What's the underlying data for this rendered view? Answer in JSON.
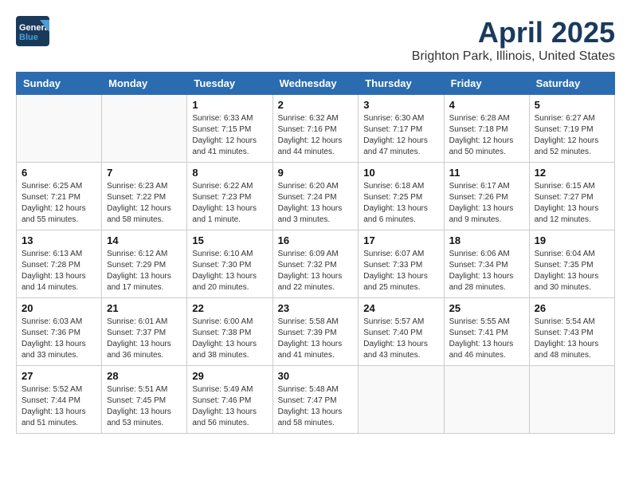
{
  "header": {
    "logo_line1": "General",
    "logo_line2": "Blue",
    "title": "April 2025",
    "subtitle": "Brighton Park, Illinois, United States"
  },
  "days_of_week": [
    "Sunday",
    "Monday",
    "Tuesday",
    "Wednesday",
    "Thursday",
    "Friday",
    "Saturday"
  ],
  "weeks": [
    [
      {
        "day": "",
        "info": ""
      },
      {
        "day": "",
        "info": ""
      },
      {
        "day": "1",
        "info": "Sunrise: 6:33 AM\nSunset: 7:15 PM\nDaylight: 12 hours and 41 minutes."
      },
      {
        "day": "2",
        "info": "Sunrise: 6:32 AM\nSunset: 7:16 PM\nDaylight: 12 hours and 44 minutes."
      },
      {
        "day": "3",
        "info": "Sunrise: 6:30 AM\nSunset: 7:17 PM\nDaylight: 12 hours and 47 minutes."
      },
      {
        "day": "4",
        "info": "Sunrise: 6:28 AM\nSunset: 7:18 PM\nDaylight: 12 hours and 50 minutes."
      },
      {
        "day": "5",
        "info": "Sunrise: 6:27 AM\nSunset: 7:19 PM\nDaylight: 12 hours and 52 minutes."
      }
    ],
    [
      {
        "day": "6",
        "info": "Sunrise: 6:25 AM\nSunset: 7:21 PM\nDaylight: 12 hours and 55 minutes."
      },
      {
        "day": "7",
        "info": "Sunrise: 6:23 AM\nSunset: 7:22 PM\nDaylight: 12 hours and 58 minutes."
      },
      {
        "day": "8",
        "info": "Sunrise: 6:22 AM\nSunset: 7:23 PM\nDaylight: 13 hours and 1 minute."
      },
      {
        "day": "9",
        "info": "Sunrise: 6:20 AM\nSunset: 7:24 PM\nDaylight: 13 hours and 3 minutes."
      },
      {
        "day": "10",
        "info": "Sunrise: 6:18 AM\nSunset: 7:25 PM\nDaylight: 13 hours and 6 minutes."
      },
      {
        "day": "11",
        "info": "Sunrise: 6:17 AM\nSunset: 7:26 PM\nDaylight: 13 hours and 9 minutes."
      },
      {
        "day": "12",
        "info": "Sunrise: 6:15 AM\nSunset: 7:27 PM\nDaylight: 13 hours and 12 minutes."
      }
    ],
    [
      {
        "day": "13",
        "info": "Sunrise: 6:13 AM\nSunset: 7:28 PM\nDaylight: 13 hours and 14 minutes."
      },
      {
        "day": "14",
        "info": "Sunrise: 6:12 AM\nSunset: 7:29 PM\nDaylight: 13 hours and 17 minutes."
      },
      {
        "day": "15",
        "info": "Sunrise: 6:10 AM\nSunset: 7:30 PM\nDaylight: 13 hours and 20 minutes."
      },
      {
        "day": "16",
        "info": "Sunrise: 6:09 AM\nSunset: 7:32 PM\nDaylight: 13 hours and 22 minutes."
      },
      {
        "day": "17",
        "info": "Sunrise: 6:07 AM\nSunset: 7:33 PM\nDaylight: 13 hours and 25 minutes."
      },
      {
        "day": "18",
        "info": "Sunrise: 6:06 AM\nSunset: 7:34 PM\nDaylight: 13 hours and 28 minutes."
      },
      {
        "day": "19",
        "info": "Sunrise: 6:04 AM\nSunset: 7:35 PM\nDaylight: 13 hours and 30 minutes."
      }
    ],
    [
      {
        "day": "20",
        "info": "Sunrise: 6:03 AM\nSunset: 7:36 PM\nDaylight: 13 hours and 33 minutes."
      },
      {
        "day": "21",
        "info": "Sunrise: 6:01 AM\nSunset: 7:37 PM\nDaylight: 13 hours and 36 minutes."
      },
      {
        "day": "22",
        "info": "Sunrise: 6:00 AM\nSunset: 7:38 PM\nDaylight: 13 hours and 38 minutes."
      },
      {
        "day": "23",
        "info": "Sunrise: 5:58 AM\nSunset: 7:39 PM\nDaylight: 13 hours and 41 minutes."
      },
      {
        "day": "24",
        "info": "Sunrise: 5:57 AM\nSunset: 7:40 PM\nDaylight: 13 hours and 43 minutes."
      },
      {
        "day": "25",
        "info": "Sunrise: 5:55 AM\nSunset: 7:41 PM\nDaylight: 13 hours and 46 minutes."
      },
      {
        "day": "26",
        "info": "Sunrise: 5:54 AM\nSunset: 7:43 PM\nDaylight: 13 hours and 48 minutes."
      }
    ],
    [
      {
        "day": "27",
        "info": "Sunrise: 5:52 AM\nSunset: 7:44 PM\nDaylight: 13 hours and 51 minutes."
      },
      {
        "day": "28",
        "info": "Sunrise: 5:51 AM\nSunset: 7:45 PM\nDaylight: 13 hours and 53 minutes."
      },
      {
        "day": "29",
        "info": "Sunrise: 5:49 AM\nSunset: 7:46 PM\nDaylight: 13 hours and 56 minutes."
      },
      {
        "day": "30",
        "info": "Sunrise: 5:48 AM\nSunset: 7:47 PM\nDaylight: 13 hours and 58 minutes."
      },
      {
        "day": "",
        "info": ""
      },
      {
        "day": "",
        "info": ""
      },
      {
        "day": "",
        "info": ""
      }
    ]
  ]
}
